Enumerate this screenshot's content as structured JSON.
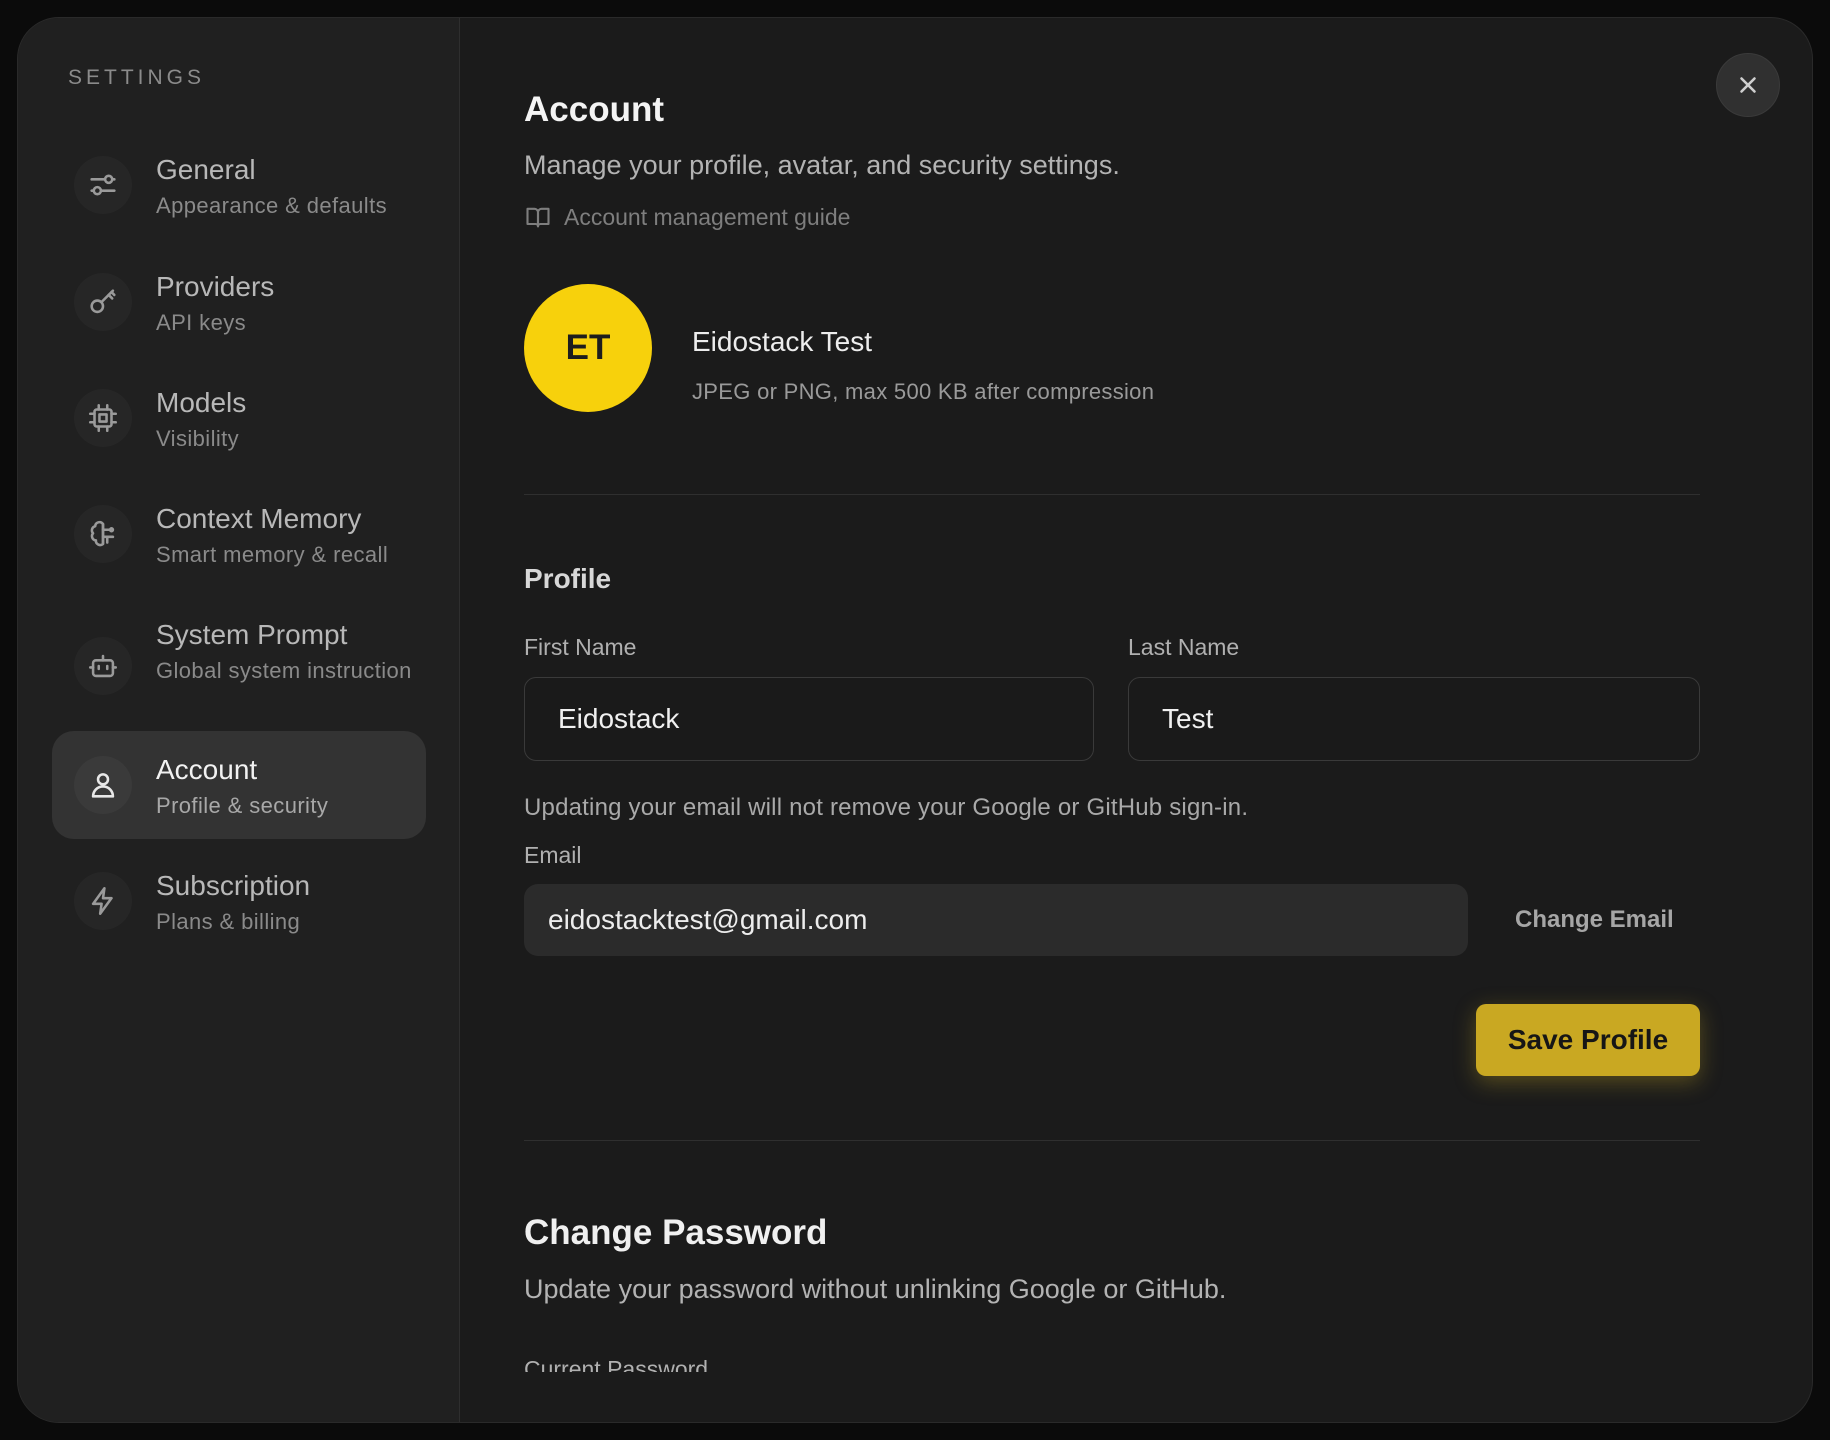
{
  "sidebar": {
    "heading": "SETTINGS",
    "items": [
      {
        "title": "General",
        "subtitle": "Appearance & defaults",
        "icon": "sliders-icon"
      },
      {
        "title": "Providers",
        "subtitle": "API keys",
        "icon": "key-icon"
      },
      {
        "title": "Models",
        "subtitle": "Visibility",
        "icon": "cpu-icon"
      },
      {
        "title": "Context Memory",
        "subtitle": "Smart memory & recall",
        "icon": "brain-icon"
      },
      {
        "title": "System Prompt",
        "subtitle": "Global system instruction",
        "icon": "bot-icon"
      },
      {
        "title": "Account",
        "subtitle": "Profile & security",
        "icon": "user-icon",
        "active": true
      },
      {
        "title": "Subscription",
        "subtitle": "Plans & billing",
        "icon": "lightning-icon"
      }
    ]
  },
  "header": {
    "title": "Account",
    "description": "Manage your profile, avatar, and security settings.",
    "guide_link": "Account management guide"
  },
  "avatar": {
    "initials": "ET",
    "name": "Eidostack Test",
    "hint": "JPEG or PNG, max 500 KB after compression",
    "color": "#F7D10C"
  },
  "profile": {
    "section_title": "Profile",
    "first_name_label": "First Name",
    "first_name_value": "Eidostack",
    "last_name_label": "Last Name",
    "last_name_value": "Test",
    "email_note": "Updating your email will not remove your Google or GitHub sign-in.",
    "email_label": "Email",
    "email_value": "eidostacktest@gmail.com",
    "change_email_label": "Change Email",
    "save_label": "Save Profile"
  },
  "password": {
    "title": "Change Password",
    "description": "Update your password without unlinking Google or GitHub.",
    "current_password_label": "Current Password"
  },
  "colors": {
    "accent": "#C9A822",
    "background": "#1B1B1B",
    "sidebar": "#202020"
  }
}
